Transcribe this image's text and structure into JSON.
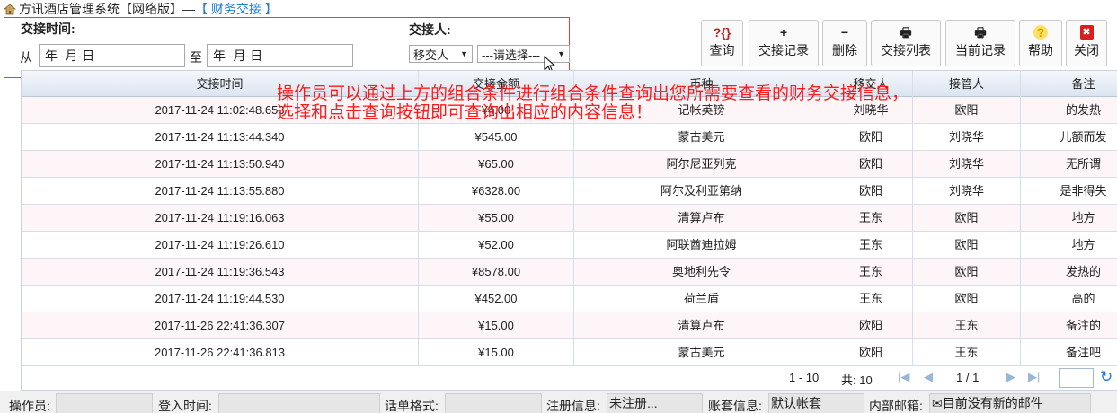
{
  "title": {
    "app": "方讯酒店管理系统【网络版】—",
    "section": "【 财务交接 】"
  },
  "filter": {
    "time_label": "交接时间:",
    "from_label": "从",
    "to_label": "至",
    "date_from": "年 -月-日",
    "date_to": "年 -月-日",
    "person_label": "交接人:",
    "person_type": "移交人",
    "person_select": "---请选择---"
  },
  "toolbar": [
    {
      "label": "查询",
      "icon": "?{}"
    },
    {
      "label": "交接记录",
      "icon": "+"
    },
    {
      "label": "删除",
      "icon": "−"
    },
    {
      "label": "交接列表",
      "icon": "🖶"
    },
    {
      "label": "当前记录",
      "icon": "🖶"
    },
    {
      "label": "帮助",
      "icon": "?"
    },
    {
      "label": "关闭",
      "icon": "✖"
    }
  ],
  "annotation": {
    "line1": "操作员可以通过上方的组合条件进行组合条件查询出您所需要查看的财务交接信息，",
    "line2": "选择和点击查询按钮即可查询出相应的内容信息！"
  },
  "table": {
    "columns": [
      "交接时间",
      "交接金额",
      "币种",
      "移交人",
      "接管人",
      "备注"
    ],
    "rows": [
      [
        "2017-11-24 11:02:48.653",
        "¥4.00",
        "记帐英镑",
        "刘晓华",
        "欧阳",
        "的发热"
      ],
      [
        "2017-11-24 11:13:44.340",
        "¥545.00",
        "蒙古美元",
        "欧阳",
        "刘晓华",
        "儿额而发"
      ],
      [
        "2017-11-24 11:13:50.940",
        "¥65.00",
        "阿尔尼亚列克",
        "欧阳",
        "刘晓华",
        "无所谓"
      ],
      [
        "2017-11-24 11:13:55.880",
        "¥6328.00",
        "阿尔及利亚第纳",
        "欧阳",
        "刘晓华",
        "是非得失"
      ],
      [
        "2017-11-24 11:19:16.063",
        "¥55.00",
        "清算卢布",
        "王东",
        "欧阳",
        "地方"
      ],
      [
        "2017-11-24 11:19:26.610",
        "¥52.00",
        "阿联酋迪拉姆",
        "王东",
        "欧阳",
        "地方"
      ],
      [
        "2017-11-24 11:19:36.543",
        "¥8578.00",
        "奥地利先令",
        "王东",
        "欧阳",
        "发热的"
      ],
      [
        "2017-11-24 11:19:44.530",
        "¥452.00",
        "荷兰盾",
        "王东",
        "欧阳",
        "高的"
      ],
      [
        "2017-11-26 22:41:36.307",
        "¥15.00",
        "清算卢布",
        "欧阳",
        "王东",
        "备注的"
      ],
      [
        "2017-11-26 22:41:36.813",
        "¥15.00",
        "蒙古美元",
        "欧阳",
        "王东",
        "备注吧"
      ]
    ]
  },
  "pager": {
    "range": "1 - 10",
    "total": "共: 10",
    "page": "1 / 1"
  },
  "status": {
    "operator_label": "操作员:",
    "operator_value": "",
    "login_label": "登入时间:",
    "login_value": "",
    "format_label": "话单格式:",
    "format_value": "",
    "reg_label": "注册信息:",
    "reg_value": "未注册...",
    "account_label": "账套信息:",
    "account_value": "默认帐套",
    "mail_label": "内部邮箱:",
    "mail_value": "目前没有新的邮件"
  }
}
